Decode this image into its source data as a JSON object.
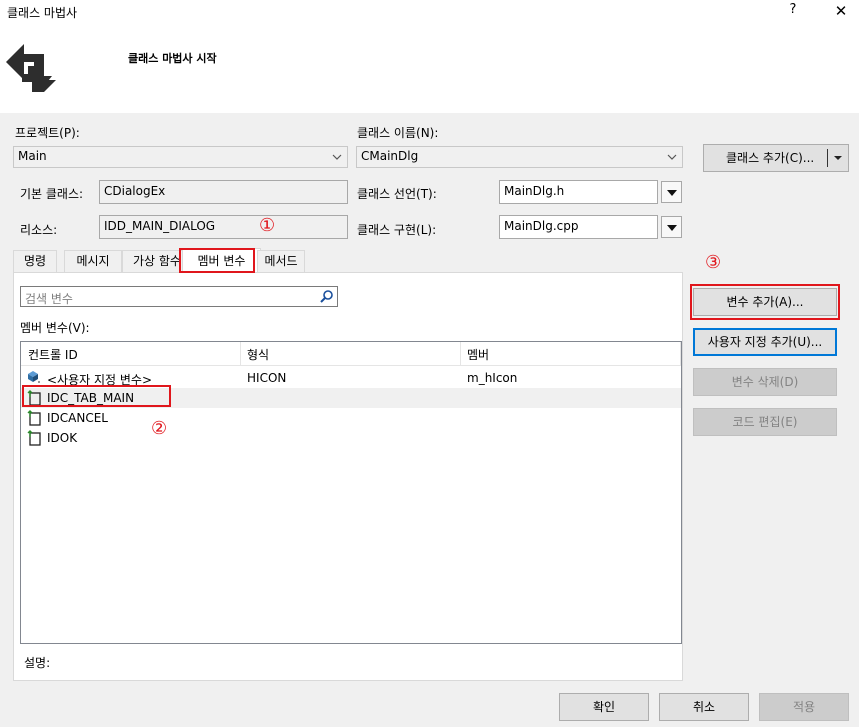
{
  "window": {
    "title": "클래스 마법사",
    "help_label": "?",
    "close_label": "✕"
  },
  "header": {
    "title": "클래스 마법사 시작"
  },
  "form": {
    "project_label": "프로젝트(P):",
    "project_value": "Main",
    "class_name_label": "클래스 이름(N):",
    "class_name_value": "CMainDlg",
    "add_class_button": "클래스 추가(C)...",
    "base_class_label": "기본 클래스:",
    "base_class_value": "CDialogEx",
    "class_decl_label": "클래스 선언(T):",
    "class_decl_value": "MainDlg.h",
    "resource_label": "리소스:",
    "resource_value": "IDD_MAIN_DIALOG",
    "class_impl_label": "클래스 구현(L):",
    "class_impl_value": "MainDlg.cpp"
  },
  "tabs": [
    {
      "label": "명령"
    },
    {
      "label": "메시지"
    },
    {
      "label": "가상 함수"
    },
    {
      "label": "멤버 변수"
    },
    {
      "label": "메서드"
    }
  ],
  "search": {
    "placeholder": "검색 변수"
  },
  "members": {
    "label": "멤버 변수(V):",
    "columns": [
      "컨트롤 ID",
      "형식",
      "멤버"
    ],
    "rows": [
      {
        "id": "<사용자 지정 변수>",
        "type": "HICON",
        "member": "m_hIcon"
      },
      {
        "id": "IDC_TAB_MAIN",
        "type": "",
        "member": ""
      },
      {
        "id": "IDCANCEL",
        "type": "",
        "member": ""
      },
      {
        "id": "IDOK",
        "type": "",
        "member": ""
      }
    ]
  },
  "side_buttons": {
    "add_variable": "변수 추가(A)...",
    "add_custom": "사용자 지정 추가(U)...",
    "delete_variable": "변수 삭제(D)",
    "edit_code": "코드 편집(E)"
  },
  "description_label": "설명:",
  "footer": {
    "ok": "확인",
    "cancel": "취소",
    "apply": "적용"
  },
  "annotations": {
    "one": "①",
    "two": "②",
    "three": "③"
  },
  "colors": {
    "annotation_red": "#e0161c",
    "focus_blue": "#0078d7"
  }
}
